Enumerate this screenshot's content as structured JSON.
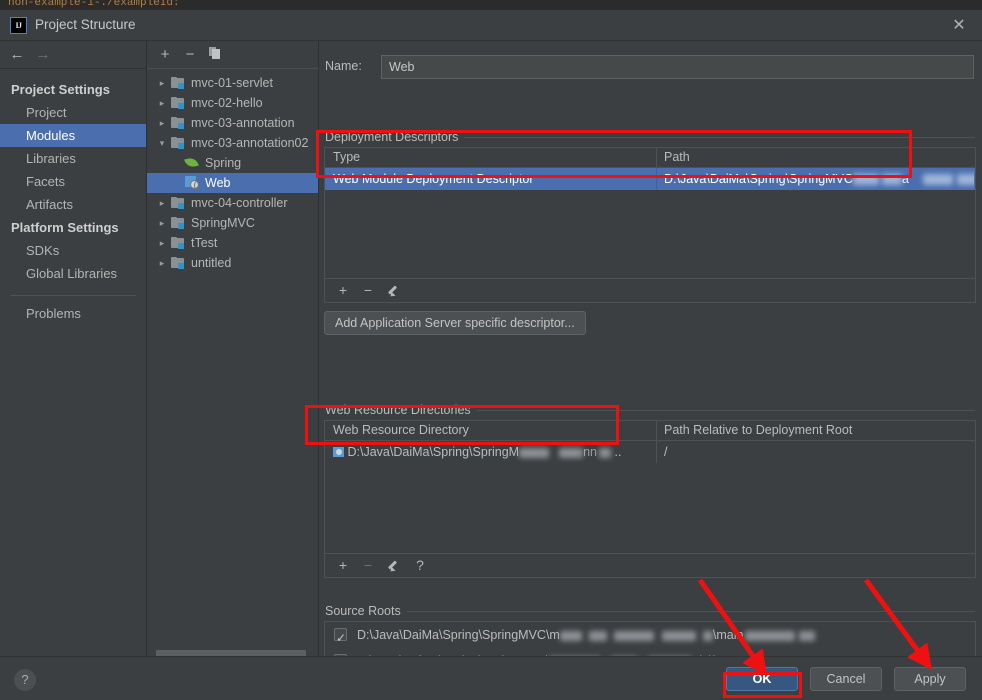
{
  "background_strip": {
    "code_text": "non-example-1-./exampleId:"
  },
  "window": {
    "title": "Project Structure",
    "logo_text": "IJ",
    "close_icon": "close-icon"
  },
  "sidebar": {
    "nav": {
      "back_icon": "arrow-left-icon",
      "forward_icon": "arrow-right-icon"
    },
    "groups": [
      {
        "label": "Project Settings",
        "items": [
          {
            "label": "Project",
            "selected": false
          },
          {
            "label": "Modules",
            "selected": true
          },
          {
            "label": "Libraries",
            "selected": false
          },
          {
            "label": "Facets",
            "selected": false
          },
          {
            "label": "Artifacts",
            "selected": false
          }
        ]
      },
      {
        "label": "Platform Settings",
        "items": [
          {
            "label": "SDKs",
            "selected": false
          },
          {
            "label": "Global Libraries",
            "selected": false
          }
        ]
      }
    ],
    "problems": {
      "label": "Problems"
    }
  },
  "tree": {
    "toolbar": {
      "add_icon": "plus-icon",
      "remove_icon": "minus-icon",
      "copy_icon": "copy-icon"
    },
    "nodes": [
      {
        "label": "mvc-01-servlet",
        "icon": "module-icon",
        "twisty": "▸",
        "depth": 0,
        "selected": false
      },
      {
        "label": "mvc-02-hello",
        "icon": "module-icon",
        "twisty": "▸",
        "depth": 0,
        "selected": false
      },
      {
        "label": "mvc-03-annotation",
        "icon": "module-icon",
        "twisty": "▸",
        "depth": 0,
        "selected": false
      },
      {
        "label": "mvc-03-annotation02",
        "icon": "module-icon",
        "twisty": "▾",
        "depth": 0,
        "selected": false
      },
      {
        "label": "Spring",
        "icon": "spring-icon",
        "twisty": "",
        "depth": 1,
        "selected": false
      },
      {
        "label": "Web",
        "icon": "web-icon",
        "twisty": "",
        "depth": 1,
        "selected": true
      },
      {
        "label": "mvc-04-controller",
        "icon": "module-icon",
        "twisty": "▸",
        "depth": 0,
        "selected": false
      },
      {
        "label": "SpringMVC",
        "icon": "module-icon",
        "twisty": "▸",
        "depth": 0,
        "selected": false
      },
      {
        "label": "tTest",
        "icon": "module-icon",
        "twisty": "▸",
        "depth": 0,
        "selected": false
      },
      {
        "label": "untitled",
        "icon": "module-icon",
        "twisty": "▸",
        "depth": 0,
        "selected": false
      }
    ]
  },
  "content": {
    "name_field": {
      "label": "Name:",
      "value": "Web",
      "placeholder": ""
    },
    "deployment_descriptors": {
      "title": "Deployment Descriptors",
      "columns": [
        "Type",
        "Path"
      ],
      "rows": [
        {
          "type": "Web Module Deployment Descriptor",
          "path_visible": "D:\\Java\\DaiMa\\Spring\\SpringMVC",
          "path_tail": "0",
          "selected": true
        }
      ],
      "toolbar": {
        "add_icon": "plus-icon",
        "remove_icon": "minus-icon",
        "edit_icon": "pencil-icon"
      },
      "add_server_button": "Add Application Server specific descriptor..."
    },
    "web_resource_directories": {
      "title": "Web Resource Directories",
      "columns": [
        "Web Resource Directory",
        "Path Relative to Deployment Root"
      ],
      "rows": [
        {
          "directory_visible": "D:\\Java\\DaiMa\\Spring\\SpringM",
          "directory_tail": "..",
          "relative_path": "/",
          "icon": "folder-web-icon"
        }
      ],
      "toolbar": {
        "add_icon": "plus-icon",
        "remove_icon": "minus-icon",
        "edit_icon": "pencil-icon",
        "help_icon": "question-icon"
      }
    },
    "source_roots": {
      "title": "Source Roots",
      "rows": [
        {
          "checked": true,
          "path_visible": "D:\\Java\\DaiMa\\Spring\\SpringMVC\\m",
          "path_mid": "\\main"
        },
        {
          "checked": true,
          "path_visible": "D:\\Java\\DaiMa\\Spring\\SpringMVC\\",
          "path_mid": "ain\\jav"
        }
      ]
    }
  },
  "footer": {
    "help_icon": "question-icon",
    "buttons": [
      {
        "label": "OK",
        "style": "primary",
        "highlighted": true
      },
      {
        "label": "Cancel",
        "style": "normal",
        "highlighted": false
      },
      {
        "label": "Apply",
        "style": "normal",
        "highlighted": false
      }
    ]
  },
  "annotations": {
    "accent_color": "#ee1111",
    "boxes": [
      {
        "name": "deployment-descriptor-row-highlight"
      },
      {
        "name": "web-resource-directory-row-highlight"
      },
      {
        "name": "ok-button-highlight"
      }
    ],
    "arrows": [
      {
        "name": "arrow-to-ok-button"
      },
      {
        "name": "arrow-to-apply-button"
      }
    ]
  }
}
